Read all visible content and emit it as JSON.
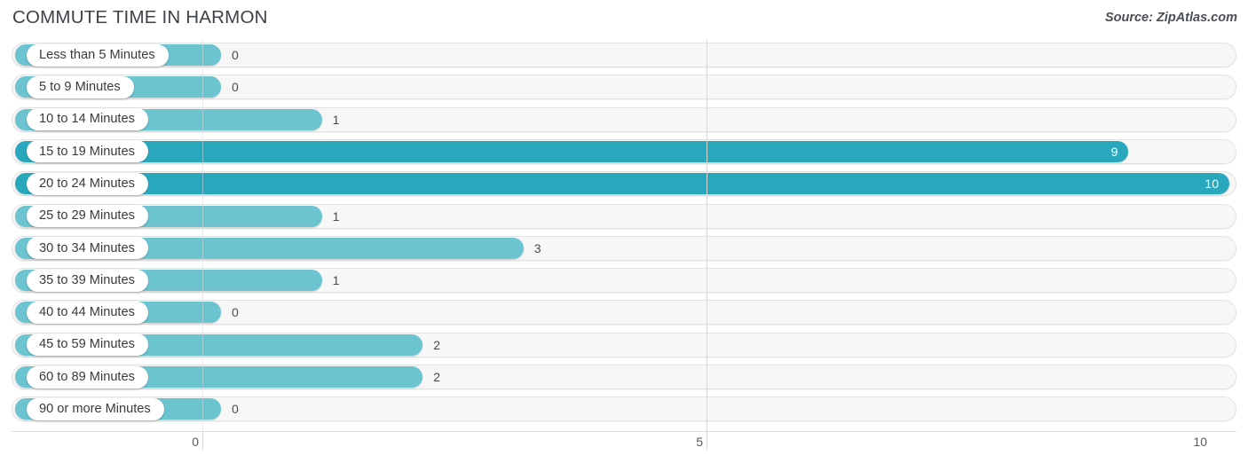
{
  "header": {
    "title": "COMMUTE TIME IN HARMON",
    "source": "Source: ZipAtlas.com"
  },
  "colors": {
    "bar_high": "#29a8bd",
    "bar_low": "#6bc4d0",
    "track_fill": "#f7f7f7",
    "track_border": "#e3e3e3",
    "gridline": "#d7d7d7",
    "title_text": "#3c4248",
    "label_text": "#3a3a3a"
  },
  "chart_data": {
    "type": "bar",
    "orientation": "horizontal",
    "title": "COMMUTE TIME IN HARMON",
    "xlabel": "",
    "ylabel": "",
    "xlim": [
      0,
      10
    ],
    "xticks": [
      0,
      5,
      10
    ],
    "xtick_labels": [
      "0",
      "5",
      "10"
    ],
    "grid": true,
    "legend": false,
    "categories": [
      "Less than 5 Minutes",
      "5 to 9 Minutes",
      "10 to 14 Minutes",
      "15 to 19 Minutes",
      "20 to 24 Minutes",
      "25 to 29 Minutes",
      "30 to 34 Minutes",
      "35 to 39 Minutes",
      "40 to 44 Minutes",
      "45 to 59 Minutes",
      "60 to 89 Minutes",
      "90 or more Minutes"
    ],
    "values": [
      0,
      0,
      1,
      9,
      10,
      1,
      3,
      1,
      0,
      2,
      2,
      0
    ],
    "value_labels": [
      "0",
      "0",
      "1",
      "9",
      "10",
      "1",
      "3",
      "1",
      "0",
      "2",
      "2",
      "0"
    ]
  },
  "rows": [
    {
      "label": "Less than 5 Minutes",
      "value": 0,
      "value_label": "0",
      "highlight": false,
      "label_inside": false
    },
    {
      "label": "5 to 9 Minutes",
      "value": 0,
      "value_label": "0",
      "highlight": false,
      "label_inside": false
    },
    {
      "label": "10 to 14 Minutes",
      "value": 1,
      "value_label": "1",
      "highlight": false,
      "label_inside": false
    },
    {
      "label": "15 to 19 Minutes",
      "value": 9,
      "value_label": "9",
      "highlight": true,
      "label_inside": true
    },
    {
      "label": "20 to 24 Minutes",
      "value": 10,
      "value_label": "10",
      "highlight": true,
      "label_inside": true
    },
    {
      "label": "25 to 29 Minutes",
      "value": 1,
      "value_label": "1",
      "highlight": false,
      "label_inside": false
    },
    {
      "label": "30 to 34 Minutes",
      "value": 3,
      "value_label": "3",
      "highlight": false,
      "label_inside": false
    },
    {
      "label": "35 to 39 Minutes",
      "value": 1,
      "value_label": "1",
      "highlight": false,
      "label_inside": false
    },
    {
      "label": "40 to 44 Minutes",
      "value": 0,
      "value_label": "0",
      "highlight": false,
      "label_inside": false
    },
    {
      "label": "45 to 59 Minutes",
      "value": 2,
      "value_label": "2",
      "highlight": false,
      "label_inside": false
    },
    {
      "label": "60 to 89 Minutes",
      "value": 2,
      "value_label": "2",
      "highlight": false,
      "label_inside": false
    },
    {
      "label": "90 or more Minutes",
      "value": 0,
      "value_label": "0",
      "highlight": false,
      "label_inside": false
    }
  ],
  "axis": {
    "ticks": [
      {
        "label": "0",
        "value": 0
      },
      {
        "label": "5",
        "value": 5
      },
      {
        "label": "10",
        "value": 10
      }
    ]
  }
}
